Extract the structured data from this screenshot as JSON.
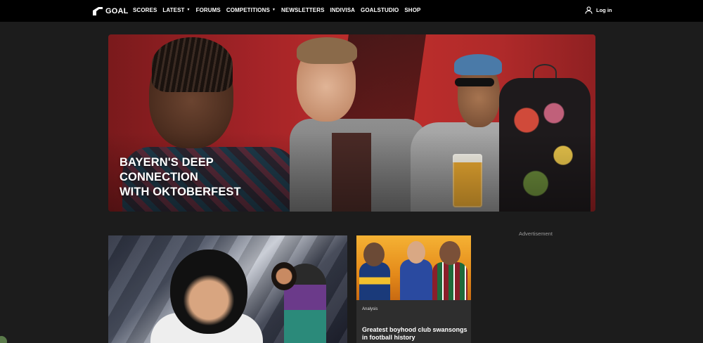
{
  "nav": {
    "logo_text": "GOAL",
    "items": [
      {
        "label": "SCORES",
        "dropdown": false
      },
      {
        "label": "LATEST",
        "dropdown": true
      },
      {
        "label": "FORUMS",
        "dropdown": false
      },
      {
        "label": "COMPETITIONS",
        "dropdown": true
      },
      {
        "label": "NEWSLETTERS",
        "dropdown": false
      },
      {
        "label": "INDIVISA",
        "dropdown": false
      },
      {
        "label": "GOALSTUDIO",
        "dropdown": false
      },
      {
        "label": "SHOP",
        "dropdown": false
      }
    ],
    "caret_glyph": "▼",
    "login_label": "Log in"
  },
  "hero": {
    "title_lines": [
      "BAYERN'S DEEP",
      "CONNECTION",
      "WITH OKTOBERFEST"
    ]
  },
  "cards": {
    "secondary": {
      "tag": "Analysis",
      "title": "Greatest boyhood club swansongs in football history"
    }
  },
  "sidebar": {
    "ad_label": "Advertisement"
  },
  "colors": {
    "nav_bg": "#000000",
    "page_bg": "#1c1c1c",
    "hero_red": "#b02a2a"
  }
}
